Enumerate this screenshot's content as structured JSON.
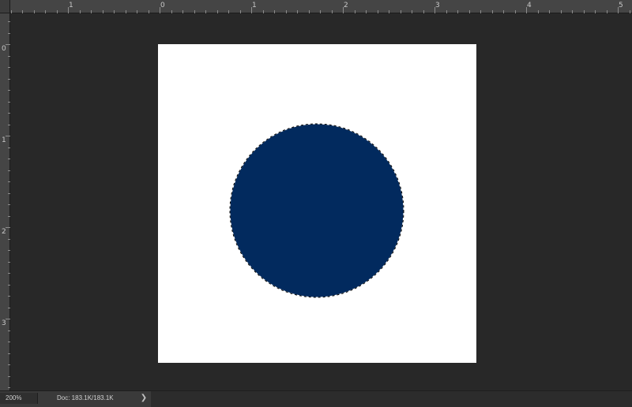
{
  "ruler": {
    "top_labels": [
      "1",
      "0",
      "1",
      "2",
      "3",
      "4",
      "5"
    ],
    "left_labels": [
      "0",
      "1",
      "2",
      "3"
    ]
  },
  "canvas": {
    "background": "#ffffff",
    "shape": "circle",
    "shape_fill": "#022a5e",
    "selection": "marching-ants"
  },
  "status_bar": {
    "zoom": "200%",
    "doc_info": "Doc: 183.1K/183.1K",
    "arrow": "❯"
  }
}
